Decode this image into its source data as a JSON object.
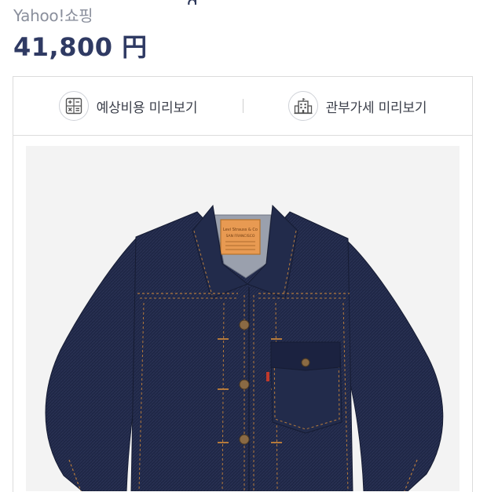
{
  "header": {
    "shop_name": "Yahoo!쇼핑",
    "price": "41,800 円"
  },
  "tools": [
    {
      "label": "예상비용 미리보기",
      "icon": "calculator-icon"
    },
    {
      "label": "관부가세 미리보기",
      "icon": "building-icon"
    }
  ],
  "product": {
    "image_alt": "denim-jacket",
    "patch_text_1": "Levi Strauss & Co",
    "patch_text_2": "SAN FRANCISCO"
  },
  "colors": {
    "price": "#2f3a63",
    "shop": "#8a8f9c",
    "denim": "#1e2642",
    "stitch": "#b57a3c",
    "patch": "#e89a52"
  }
}
